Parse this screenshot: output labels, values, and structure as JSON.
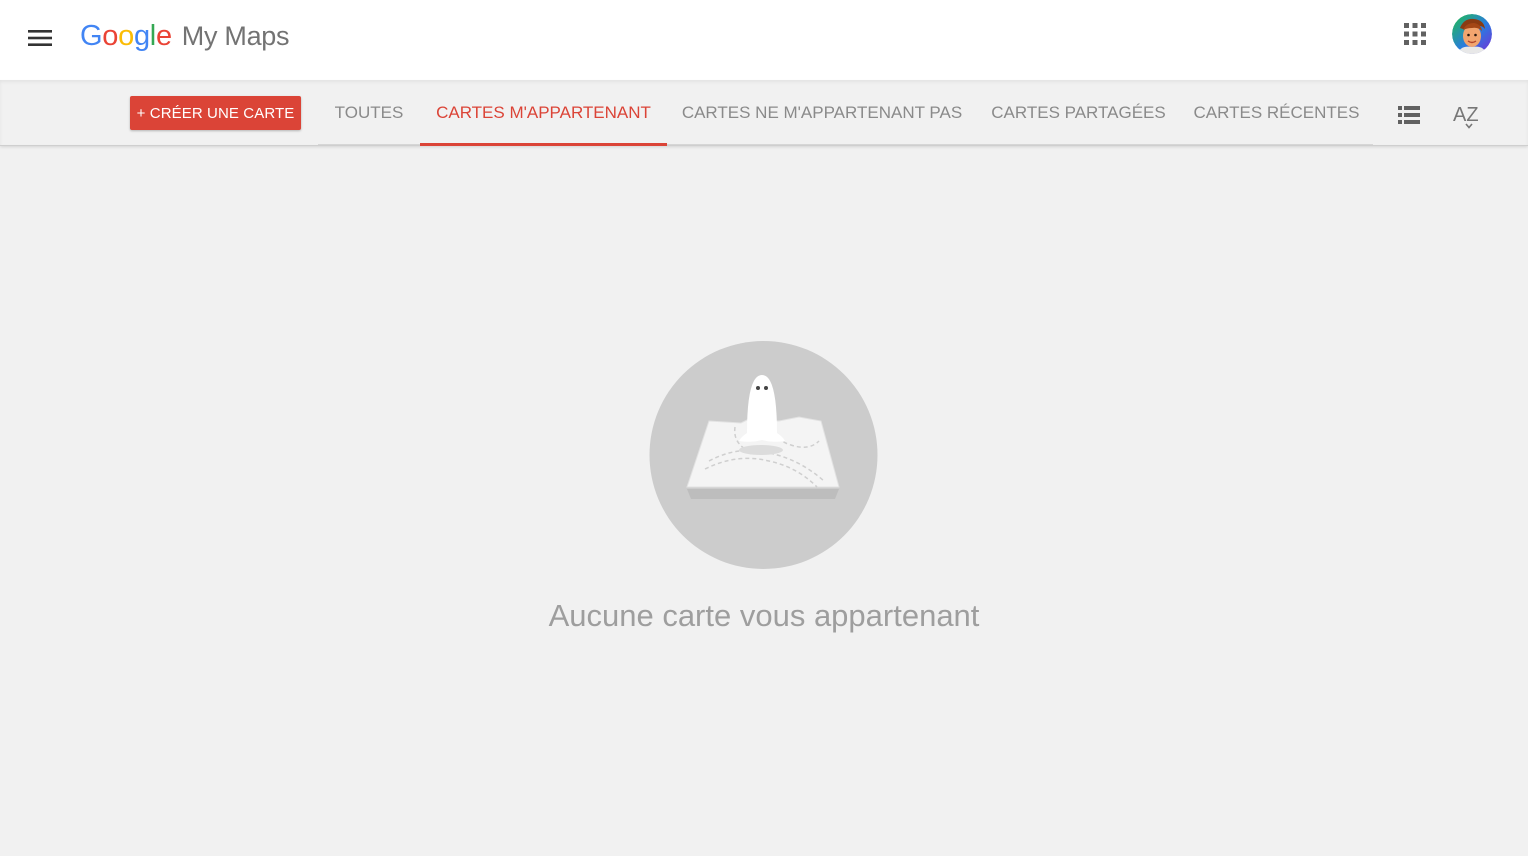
{
  "header": {
    "logo": {
      "letters": [
        {
          "ch": "G",
          "color": "#4285F4"
        },
        {
          "ch": "o",
          "color": "#EA4335"
        },
        {
          "ch": "o",
          "color": "#FBBC05"
        },
        {
          "ch": "g",
          "color": "#4285F4"
        },
        {
          "ch": "l",
          "color": "#34A853"
        },
        {
          "ch": "e",
          "color": "#EA4335"
        }
      ],
      "product": "My Maps"
    },
    "menu_icon": "hamburger-menu-icon",
    "apps_icon": "apps-grid-icon",
    "avatar_icon": "user-avatar"
  },
  "toolbar": {
    "create_label": "+ CRÉER UNE CARTE",
    "tabs": [
      {
        "label": "TOUTES",
        "active": false
      },
      {
        "label": "CARTES M'APPARTENANT",
        "active": true
      },
      {
        "label": "CARTES NE M'APPARTENANT PAS",
        "active": false
      },
      {
        "label": "CARTES PARTAGÉES",
        "active": false
      },
      {
        "label": "CARTES RÉCENTES",
        "active": false
      }
    ],
    "view_icon": "list-view-icon",
    "sort_icon": "sort-az-icon",
    "sort_label": "AZ"
  },
  "empty_state": {
    "message": "Aucune carte vous appartenant",
    "illustration": "ghost-on-map-icon"
  },
  "colors": {
    "accent": "#db4437",
    "background": "#f1f1f1",
    "muted_text": "#9e9e9e"
  }
}
